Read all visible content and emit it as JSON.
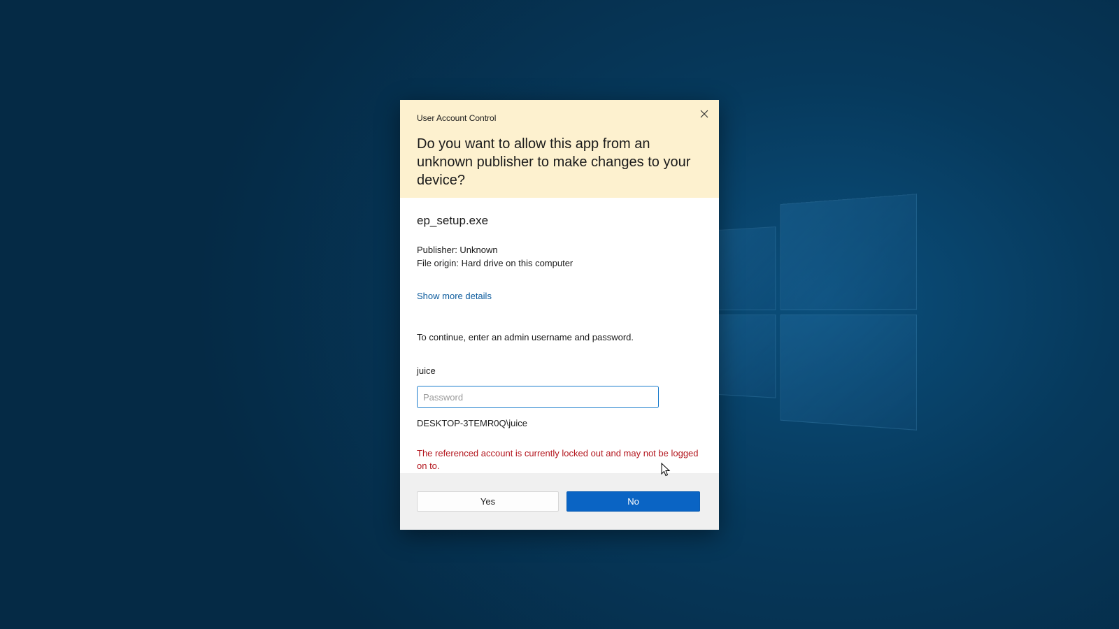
{
  "dialog": {
    "title": "User Account Control",
    "question": "Do you want to allow this app from an unknown publisher to make changes to your device?",
    "app_name": "ep_setup.exe",
    "publisher": "Publisher: Unknown",
    "file_origin": "File origin: Hard drive on this computer",
    "details_link": "Show more details",
    "instruction": "To continue, enter an admin username and password.",
    "username": "juice",
    "password": {
      "value": "",
      "placeholder": "Password"
    },
    "domain_user": "DESKTOP-3TEMR0Q\\juice",
    "error": "The referenced account is currently locked out and may not be logged on to.",
    "buttons": {
      "yes": "Yes",
      "no": "No"
    },
    "close_icon": "close-icon"
  },
  "colors": {
    "header_bg": "#fdf1cf",
    "link": "#0a5a9c",
    "error": "#b3151d",
    "primary_button": "#0a64c4",
    "desktop_bg": "#063454"
  }
}
